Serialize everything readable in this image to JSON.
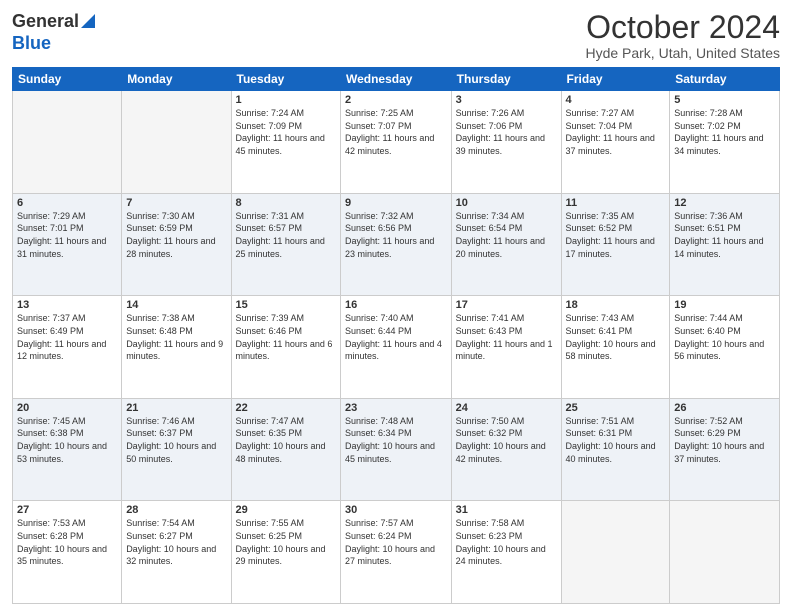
{
  "header": {
    "logo_general": "General",
    "logo_blue": "Blue",
    "month_title": "October 2024",
    "location": "Hyde Park, Utah, United States"
  },
  "weekdays": [
    "Sunday",
    "Monday",
    "Tuesday",
    "Wednesday",
    "Thursday",
    "Friday",
    "Saturday"
  ],
  "weeks": [
    [
      {
        "day": "",
        "empty": true
      },
      {
        "day": "",
        "empty": true
      },
      {
        "day": "1",
        "sunrise": "7:24 AM",
        "sunset": "7:09 PM",
        "daylight": "11 hours and 45 minutes."
      },
      {
        "day": "2",
        "sunrise": "7:25 AM",
        "sunset": "7:07 PM",
        "daylight": "11 hours and 42 minutes."
      },
      {
        "day": "3",
        "sunrise": "7:26 AM",
        "sunset": "7:06 PM",
        "daylight": "11 hours and 39 minutes."
      },
      {
        "day": "4",
        "sunrise": "7:27 AM",
        "sunset": "7:04 PM",
        "daylight": "11 hours and 37 minutes."
      },
      {
        "day": "5",
        "sunrise": "7:28 AM",
        "sunset": "7:02 PM",
        "daylight": "11 hours and 34 minutes."
      }
    ],
    [
      {
        "day": "6",
        "sunrise": "7:29 AM",
        "sunset": "7:01 PM",
        "daylight": "11 hours and 31 minutes."
      },
      {
        "day": "7",
        "sunrise": "7:30 AM",
        "sunset": "6:59 PM",
        "daylight": "11 hours and 28 minutes."
      },
      {
        "day": "8",
        "sunrise": "7:31 AM",
        "sunset": "6:57 PM",
        "daylight": "11 hours and 25 minutes."
      },
      {
        "day": "9",
        "sunrise": "7:32 AM",
        "sunset": "6:56 PM",
        "daylight": "11 hours and 23 minutes."
      },
      {
        "day": "10",
        "sunrise": "7:34 AM",
        "sunset": "6:54 PM",
        "daylight": "11 hours and 20 minutes."
      },
      {
        "day": "11",
        "sunrise": "7:35 AM",
        "sunset": "6:52 PM",
        "daylight": "11 hours and 17 minutes."
      },
      {
        "day": "12",
        "sunrise": "7:36 AM",
        "sunset": "6:51 PM",
        "daylight": "11 hours and 14 minutes."
      }
    ],
    [
      {
        "day": "13",
        "sunrise": "7:37 AM",
        "sunset": "6:49 PM",
        "daylight": "11 hours and 12 minutes."
      },
      {
        "day": "14",
        "sunrise": "7:38 AM",
        "sunset": "6:48 PM",
        "daylight": "11 hours and 9 minutes."
      },
      {
        "day": "15",
        "sunrise": "7:39 AM",
        "sunset": "6:46 PM",
        "daylight": "11 hours and 6 minutes."
      },
      {
        "day": "16",
        "sunrise": "7:40 AM",
        "sunset": "6:44 PM",
        "daylight": "11 hours and 4 minutes."
      },
      {
        "day": "17",
        "sunrise": "7:41 AM",
        "sunset": "6:43 PM",
        "daylight": "11 hours and 1 minute."
      },
      {
        "day": "18",
        "sunrise": "7:43 AM",
        "sunset": "6:41 PM",
        "daylight": "10 hours and 58 minutes."
      },
      {
        "day": "19",
        "sunrise": "7:44 AM",
        "sunset": "6:40 PM",
        "daylight": "10 hours and 56 minutes."
      }
    ],
    [
      {
        "day": "20",
        "sunrise": "7:45 AM",
        "sunset": "6:38 PM",
        "daylight": "10 hours and 53 minutes."
      },
      {
        "day": "21",
        "sunrise": "7:46 AM",
        "sunset": "6:37 PM",
        "daylight": "10 hours and 50 minutes."
      },
      {
        "day": "22",
        "sunrise": "7:47 AM",
        "sunset": "6:35 PM",
        "daylight": "10 hours and 48 minutes."
      },
      {
        "day": "23",
        "sunrise": "7:48 AM",
        "sunset": "6:34 PM",
        "daylight": "10 hours and 45 minutes."
      },
      {
        "day": "24",
        "sunrise": "7:50 AM",
        "sunset": "6:32 PM",
        "daylight": "10 hours and 42 minutes."
      },
      {
        "day": "25",
        "sunrise": "7:51 AM",
        "sunset": "6:31 PM",
        "daylight": "10 hours and 40 minutes."
      },
      {
        "day": "26",
        "sunrise": "7:52 AM",
        "sunset": "6:29 PM",
        "daylight": "10 hours and 37 minutes."
      }
    ],
    [
      {
        "day": "27",
        "sunrise": "7:53 AM",
        "sunset": "6:28 PM",
        "daylight": "10 hours and 35 minutes."
      },
      {
        "day": "28",
        "sunrise": "7:54 AM",
        "sunset": "6:27 PM",
        "daylight": "10 hours and 32 minutes."
      },
      {
        "day": "29",
        "sunrise": "7:55 AM",
        "sunset": "6:25 PM",
        "daylight": "10 hours and 29 minutes."
      },
      {
        "day": "30",
        "sunrise": "7:57 AM",
        "sunset": "6:24 PM",
        "daylight": "10 hours and 27 minutes."
      },
      {
        "day": "31",
        "sunrise": "7:58 AM",
        "sunset": "6:23 PM",
        "daylight": "10 hours and 24 minutes."
      },
      {
        "day": "",
        "empty": true
      },
      {
        "day": "",
        "empty": true
      }
    ]
  ]
}
